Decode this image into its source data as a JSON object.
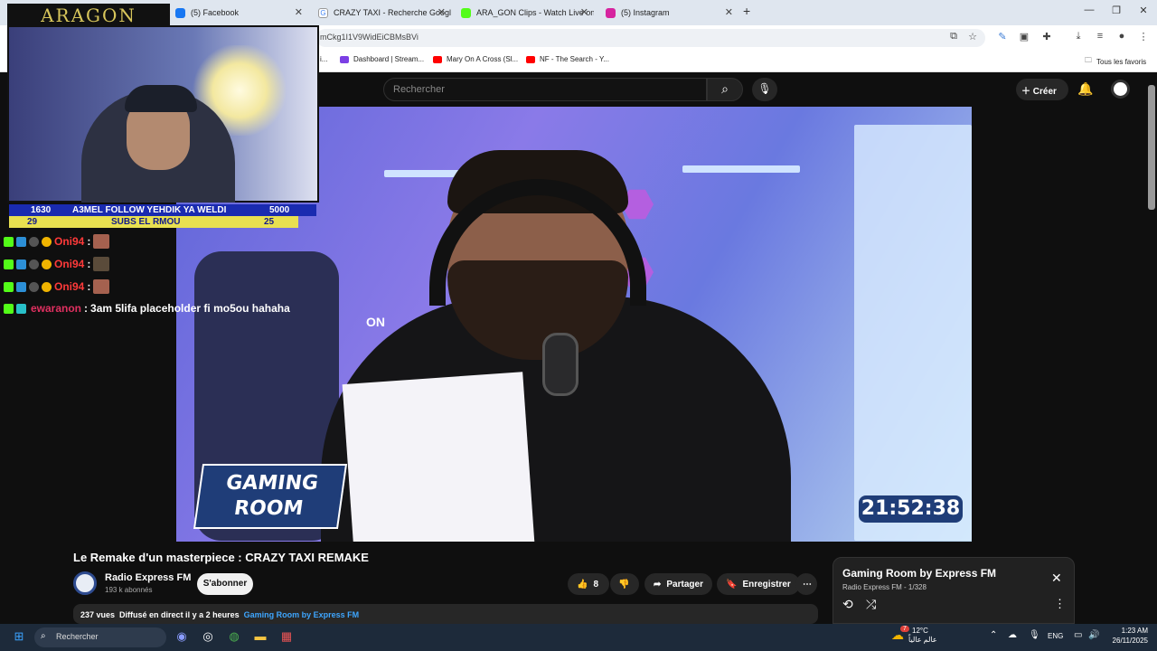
{
  "browser": {
    "tabs": [
      {
        "label": "(5) Facebook",
        "active": false
      },
      {
        "label": "CRAZY TAXI - Recherche Googl",
        "active": false
      },
      {
        "label": "ARA_GON Clips - Watch Live on",
        "active": false
      },
      {
        "label": "(5) Instagram",
        "active": false
      }
    ],
    "url": "mCkg1I1V9WidEiCBMsBVi",
    "bookmarks": [
      {
        "label": "Dashboard | Stream..."
      },
      {
        "label": "Mary On A Cross (Sl..."
      },
      {
        "label": "NF - The Search - Y..."
      }
    ],
    "bookmarks_folder": "Tous les favoris",
    "bookmark_partial": "i..."
  },
  "youtube": {
    "search_placeholder": "Rechercher",
    "create_label": "Créer",
    "video_title": "Le Remake d'un masterpiece : CRAZY TAXI REMAKE",
    "channel_name": "Radio Express FM",
    "channel_subs": "193 k abonnés",
    "subscribe_label": "S'abonner",
    "likes": "8",
    "share_label": "Partager",
    "save_label": "Enregistrer",
    "views": "237 vues",
    "streamed": "Diffusé en direct il y a 2 heures",
    "playlist_link": "Gaming Room by Express FM",
    "playlist": {
      "title": "Gaming Room by Express FM",
      "subtitle": "Radio Express FM - 1/328"
    }
  },
  "video_overlay": {
    "logo_line1": "GAMING",
    "logo_line2": "ROOM",
    "timer": "21:52:38",
    "on_text": "ON"
  },
  "stream_overlay": {
    "streamer_logo": "ARAGON",
    "goal_left_top": "1630",
    "goal_text_top": "A3MEL FOLLOW YEHDIK YA WELDI",
    "goal_right_top": "5000",
    "goal_left_bottom": "29",
    "goal_text_bottom": "SUBS EL RMOU",
    "goal_right_bottom": "25",
    "chat": [
      {
        "user": "Oni94",
        "message": ""
      },
      {
        "user": "Oni94",
        "message": ""
      },
      {
        "user": "Oni94",
        "message": ""
      },
      {
        "user": "ewaranon",
        "message": "3am 5lifa placeholder fi mo5ou hahaha"
      }
    ]
  },
  "taskbar": {
    "search_label": "Rechercher",
    "weather_temp": "12°C",
    "weather_text": "عالم عالياً",
    "weather_badge": "7",
    "lang": "ENG",
    "time": "1:23 AM",
    "date": "26/11/2025"
  },
  "colors": {
    "accent_link": "#3ea6ff",
    "chat_user": "#ff3a3a",
    "chat_user2": "#e03060"
  }
}
